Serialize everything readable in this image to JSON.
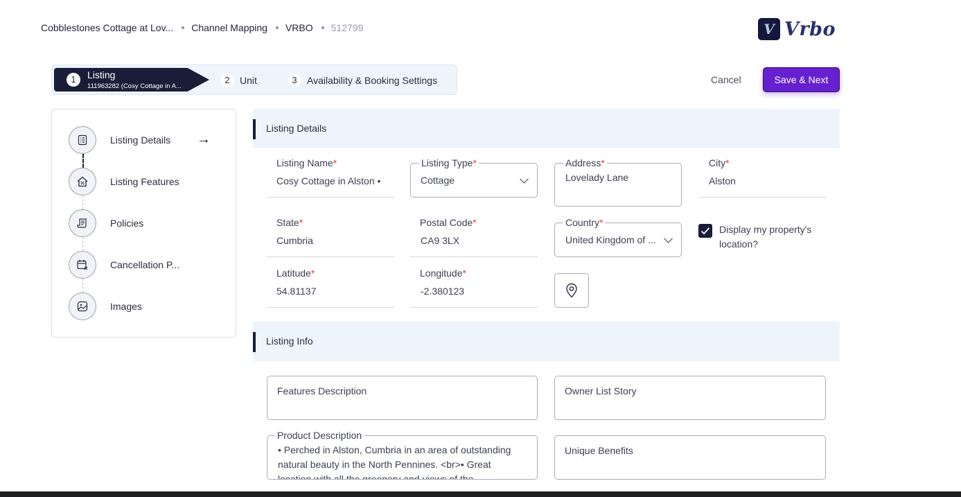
{
  "breadcrumb": {
    "property": "Cobblestones Cottage at Lov...",
    "section": "Channel Mapping",
    "channel": "VRBO",
    "id": "512799"
  },
  "logo": {
    "badge": "V",
    "text": "Vrbo"
  },
  "stepper": {
    "steps": [
      {
        "num": "1",
        "label": "Listing",
        "sub": "111963282 (Cosy Cottage in A..."
      },
      {
        "num": "2",
        "label": "Unit"
      },
      {
        "num": "3",
        "label": "Availability & Booking Settings"
      }
    ]
  },
  "actions": {
    "cancel": "Cancel",
    "save": "Save & Next"
  },
  "sidebar": {
    "items": [
      {
        "label": "Listing Details",
        "icon": "document-list-icon"
      },
      {
        "label": "Listing Features",
        "icon": "home-percent-icon"
      },
      {
        "label": "Policies",
        "icon": "receipt-icon"
      },
      {
        "label": "Cancellation P...",
        "icon": "calendar-x-icon"
      },
      {
        "label": "Images",
        "icon": "image-icon"
      }
    ]
  },
  "listing_details": {
    "title": "Listing Details",
    "required_mark": "*",
    "listing_name": {
      "label": "Listing Name",
      "value": "Cosy Cottage in Alston •"
    },
    "listing_type": {
      "label": "Listing Type",
      "value": "Cottage"
    },
    "address": {
      "label": "Address",
      "value": "Lovelady Lane"
    },
    "city": {
      "label": "City",
      "value": "Alston"
    },
    "state": {
      "label": "State",
      "value": "Cumbria"
    },
    "postal_code": {
      "label": "Postal Code",
      "value": "CA9 3LX"
    },
    "country": {
      "label": "Country",
      "value": "United Kingdom of ..."
    },
    "display_location": {
      "label": "Display my property's location?",
      "checked": true
    },
    "latitude": {
      "label": "Latitude",
      "value": "54.81137"
    },
    "longitude": {
      "label": "Longitude",
      "value": "-2.380123"
    }
  },
  "listing_info": {
    "title": "Listing Info",
    "features_description": {
      "placeholder": "Features Description"
    },
    "owner_list_story": {
      "placeholder": "Owner List Story"
    },
    "product_description": {
      "label": "Product Description",
      "value": "• Perched in Alston, Cumbria in an area of outstanding natural beauty in the North Pennines. <br>• Great location with all the greenery and views of the"
    },
    "unique_benefits": {
      "placeholder": "Unique Benefits"
    }
  }
}
